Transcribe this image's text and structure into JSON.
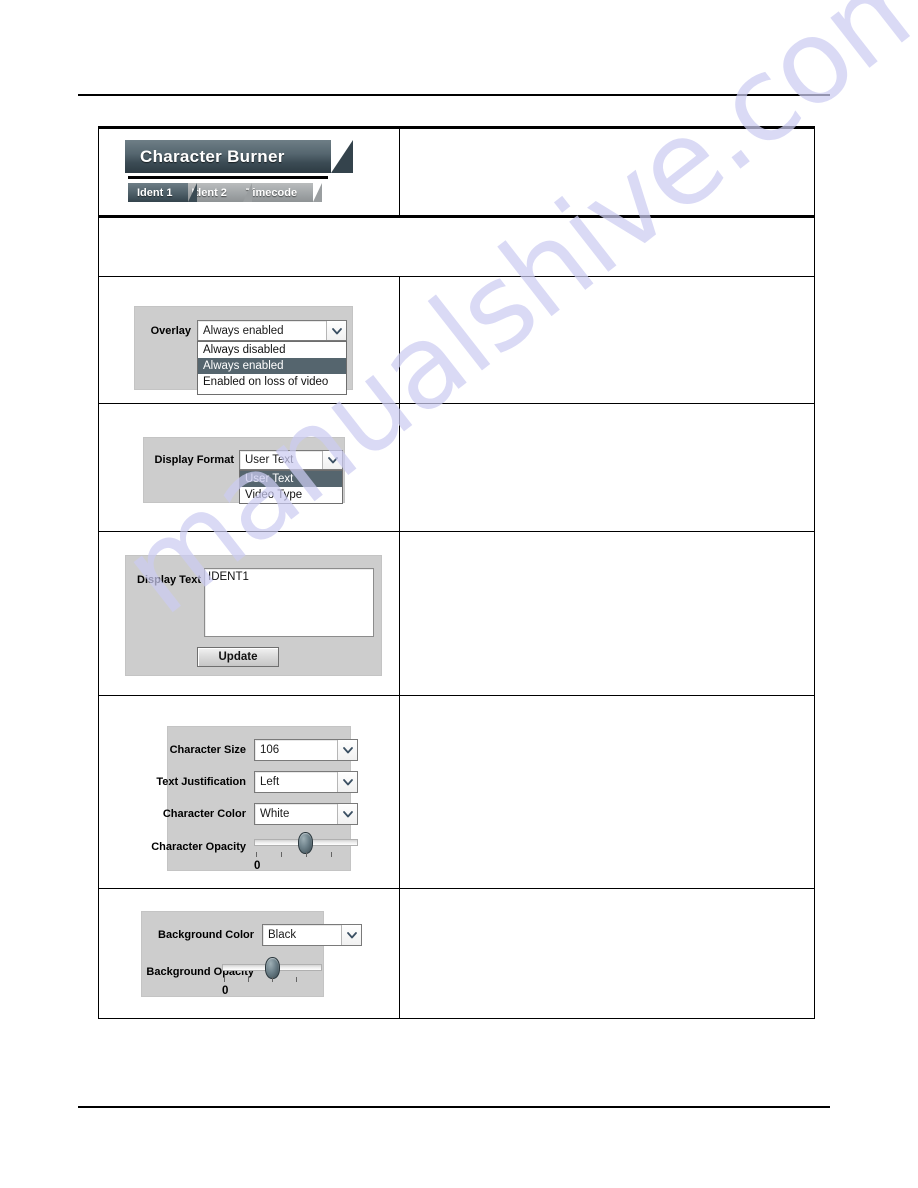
{
  "watermark": {
    "text": "manualshive.com"
  },
  "widget": {
    "title": "Character Burner",
    "tabs": [
      {
        "label": "Ident 1",
        "active": true
      },
      {
        "label": "Ident 2",
        "active": false
      },
      {
        "label": "Timecode",
        "active": false
      }
    ]
  },
  "overlay": {
    "label": "Overlay",
    "value": "Always enabled",
    "options": [
      "Always disabled",
      "Always enabled",
      "Enabled on loss of video"
    ],
    "selected_option": "Always enabled"
  },
  "display_format": {
    "label": "Display Format",
    "value": "User Text",
    "options": [
      "User Text",
      "Video Type"
    ],
    "selected_option": "User Text"
  },
  "display_text": {
    "label": "Display Text",
    "value": "IDENT1",
    "update_label": "Update"
  },
  "character": {
    "size_label": "Character Size",
    "size_value": "106",
    "justification_label": "Text Justification",
    "justification_value": "Left",
    "color_label": "Character Color",
    "color_value": "White",
    "opacity_label": "Character Opacity",
    "opacity_value": "0"
  },
  "background": {
    "color_label": "Background Color",
    "color_value": "Black",
    "opacity_label": "Background Opacity",
    "opacity_value": "0"
  },
  "colors": {
    "panel_grey": "#cdcdcd",
    "banner_dark": "#3c4c55",
    "highlight_blue_grey": "#55656e",
    "watermark_purple": "#ccccf2"
  }
}
